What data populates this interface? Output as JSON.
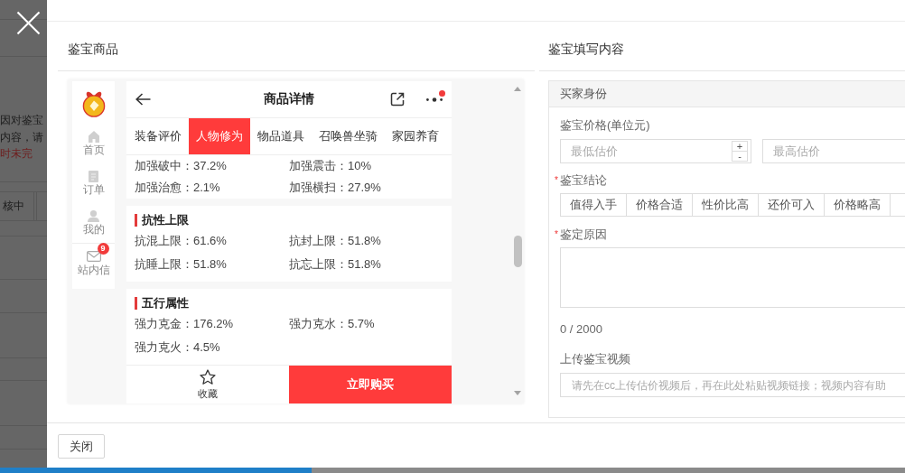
{
  "background_page": {
    "lines": [
      {
        "text": "因对鉴宝",
        "kind": "normal"
      },
      {
        "text": "内容，请",
        "kind": "normal"
      },
      {
        "text": "时未完",
        "kind": "warning"
      }
    ],
    "status_cell": "核中"
  },
  "left_panel": {
    "title": "鉴宝商品",
    "phone": {
      "sidebar": [
        {
          "label": "首页"
        },
        {
          "label": "订单"
        },
        {
          "label": "我的"
        },
        {
          "label": "站内信",
          "badge": "9"
        }
      ],
      "header": {
        "title": "商品详情",
        "notification_dot": true
      },
      "tabs": [
        {
          "label": "装备评价",
          "selected": false
        },
        {
          "label": "人物修为",
          "selected": true
        },
        {
          "label": "物品道具",
          "selected": false
        },
        {
          "label": "召唤兽坐骑",
          "selected": false
        },
        {
          "label": "家园养育",
          "selected": false
        }
      ],
      "sections": [
        {
          "items": [
            "加强破中：37.2%",
            "加强震击：10%",
            "加强治愈：2.1%",
            "加强横扫：27.9%"
          ]
        },
        {
          "title": "抗性上限",
          "items": [
            "抗混上限：61.6%",
            "抗封上限：51.8%",
            "抗睡上限：51.8%",
            "抗忘上限：51.8%"
          ]
        },
        {
          "title": "五行属性",
          "items": [
            "强力克金：176.2%",
            "强力克水：5.7%",
            "强力克火：4.5%"
          ]
        }
      ],
      "bottom_bar": {
        "favorite_label": "收藏",
        "buy_button": "立即购买"
      }
    }
  },
  "right_panel": {
    "title": "鉴宝填写内容",
    "section_title": "买家身份",
    "price": {
      "label": "鉴宝价格(单位元)",
      "min_placeholder": "最低估价",
      "stepper": [
        "+",
        "-"
      ],
      "max_placeholder": "最高估价"
    },
    "conclusion": {
      "required_mark": "*",
      "label": "鉴宝结论",
      "options": [
        {
          "label": "值得入手",
          "selected": false
        },
        {
          "label": "价格合适",
          "selected": false
        },
        {
          "label": "性价比高",
          "selected": false
        },
        {
          "label": "还价可入",
          "selected": false
        },
        {
          "label": "价格略高",
          "selected": false
        }
      ]
    },
    "reason": {
      "required_mark": "*",
      "label": "鉴定原因",
      "counter": "0 / 2000"
    },
    "video": {
      "label": "上传鉴宝视频",
      "placeholder": "请先在cc上传估价视频后，再在此处粘贴视频链接；视频内容有助"
    }
  },
  "footer": {
    "close_button": "关闭"
  }
}
